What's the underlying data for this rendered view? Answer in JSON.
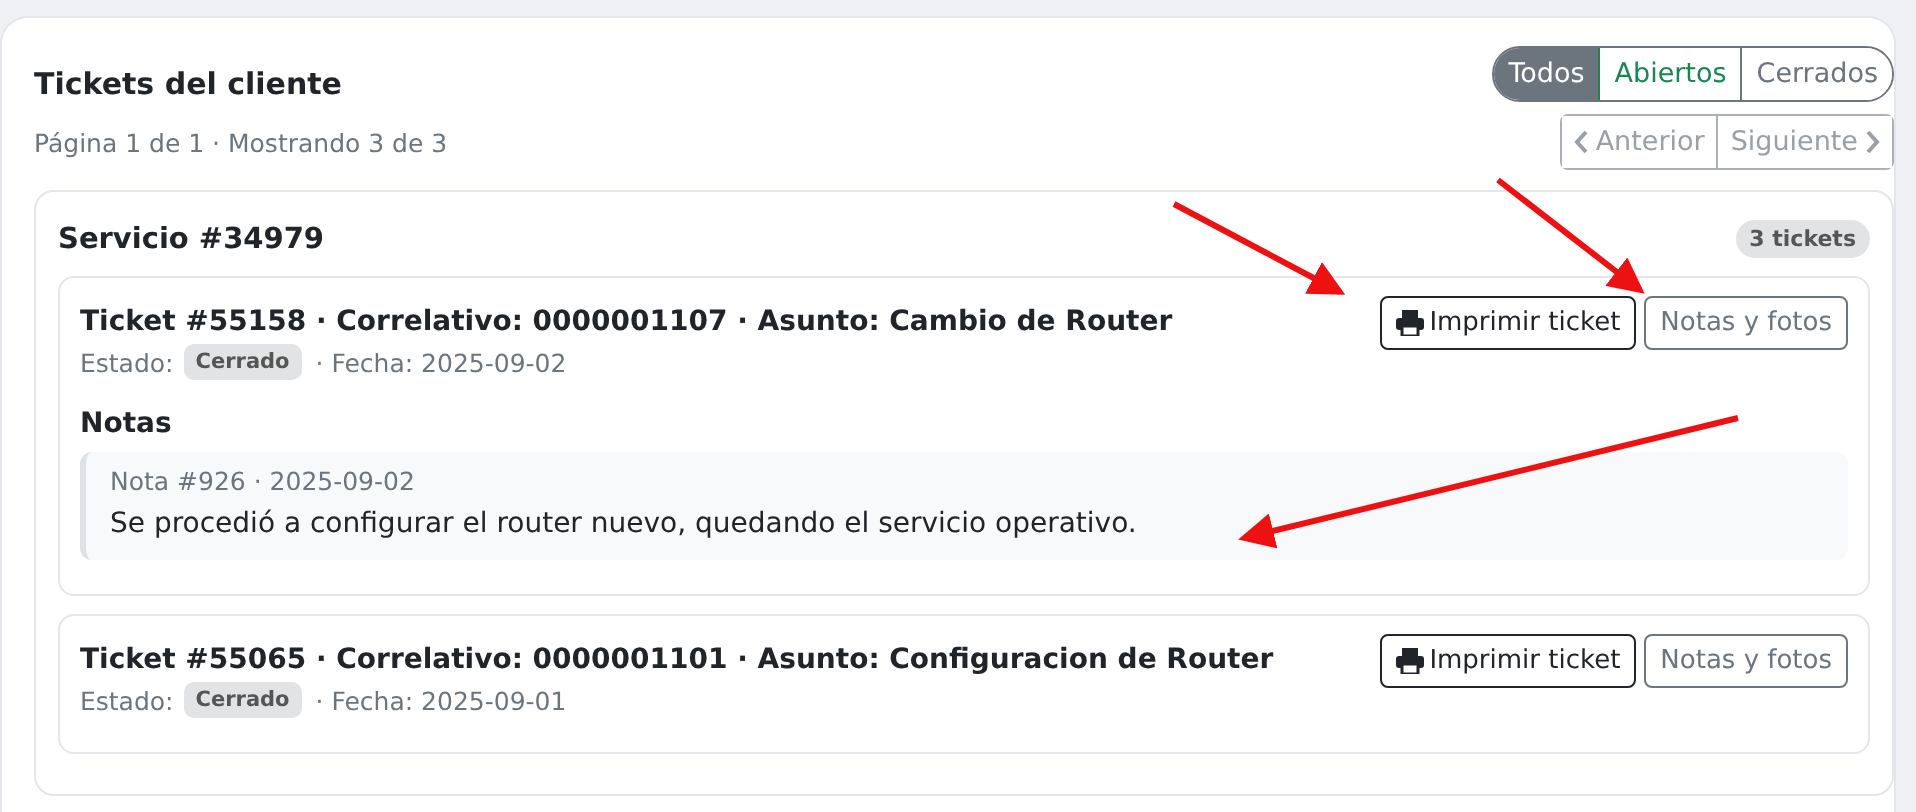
{
  "title": "Tickets del cliente",
  "filters": [
    {
      "label": "Todos",
      "kind": "all",
      "selected": true
    },
    {
      "label": "Abiertos",
      "kind": "open",
      "selected": false
    },
    {
      "label": "Cerrados",
      "kind": "closed",
      "selected": false
    }
  ],
  "page_info": "Página 1 de 1 · Mostrando 3 de 3",
  "pagination": [
    {
      "label": "Anterior",
      "kind": "prev",
      "disabled": true
    },
    {
      "label": "Siguiente",
      "kind": "next",
      "disabled": true
    }
  ],
  "services": [
    {
      "title": "Servicio #34979",
      "count": "3 tickets",
      "tickets": [
        {
          "title": "Ticket #55158 · Correlativo: 0000001107 · Asunto: Cambio de Router",
          "status_label": "Estado:",
          "status": "Cerrado",
          "date": "· Fecha: 2025-09-02",
          "print_button": "Imprimir ticket",
          "notes_button": "Notas y fotos",
          "notes_title": "Notas",
          "notes": [
            {
              "meta": "Nota #926 · 2025-09-02",
              "text": "Se procedió a configurar el router nuevo, quedando el servicio operativo."
            }
          ]
        },
        {
          "title": "Ticket #55065 · Correlativo: 0000001101 · Asunto: Configuracion de Router",
          "status_label": "Estado:",
          "status": "Cerrado",
          "date": "· Fecha: 2025-09-01",
          "print_button": "Imprimir ticket",
          "notes_button": "Notas y fotos"
        }
      ]
    }
  ]
}
